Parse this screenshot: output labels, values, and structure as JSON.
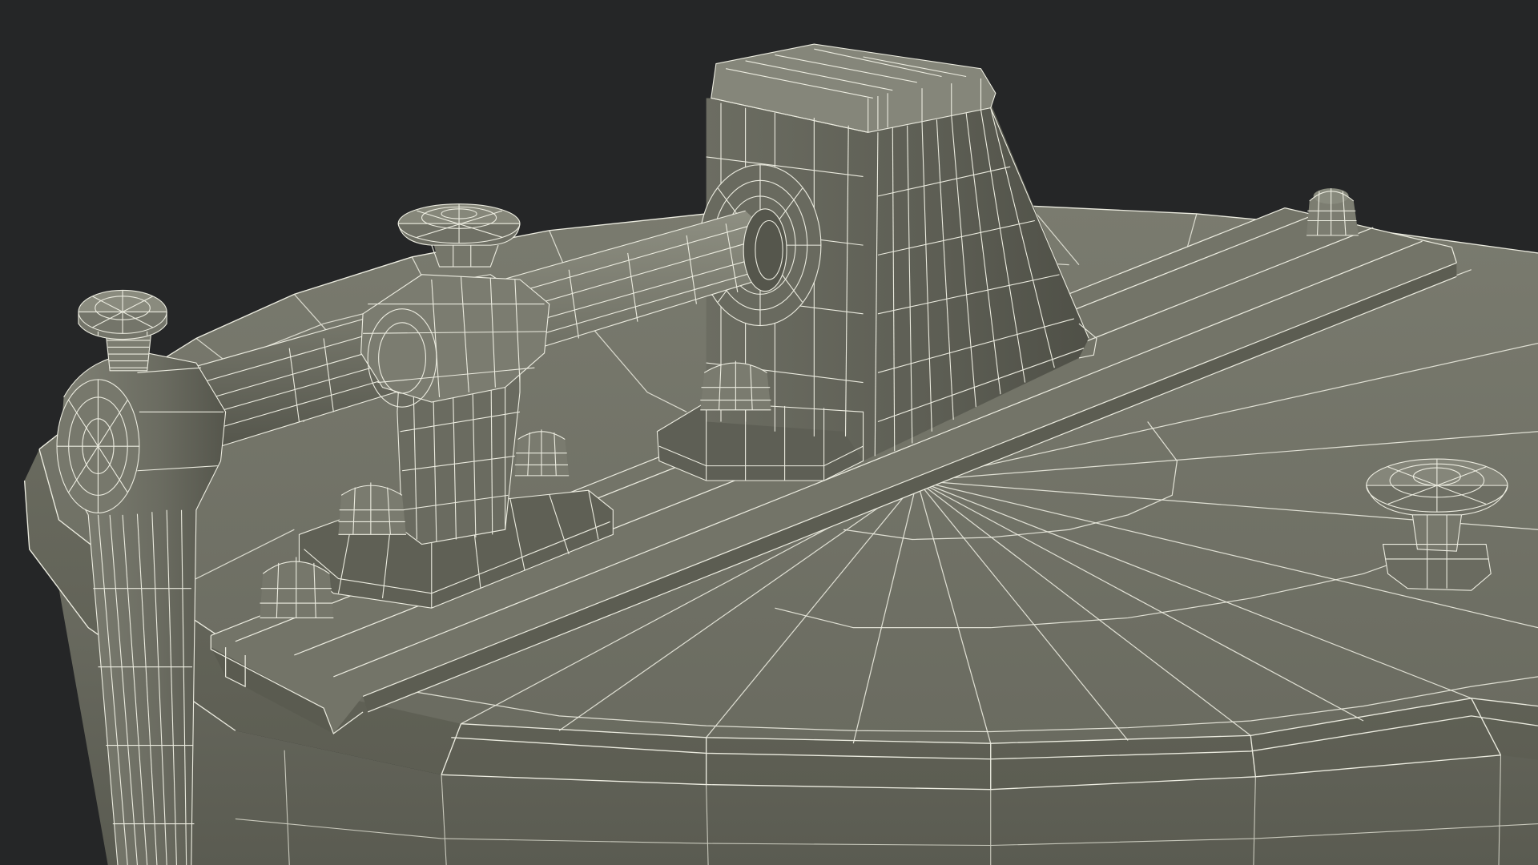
{
  "scene": {
    "subject": "wireframe-render-of-honey-extractor-lid",
    "colors": {
      "background": "#252627",
      "surface": "#6e6f63",
      "surface_light": "#86877a",
      "surface_dark": "#505146",
      "wire": "#e9e9dc"
    }
  }
}
